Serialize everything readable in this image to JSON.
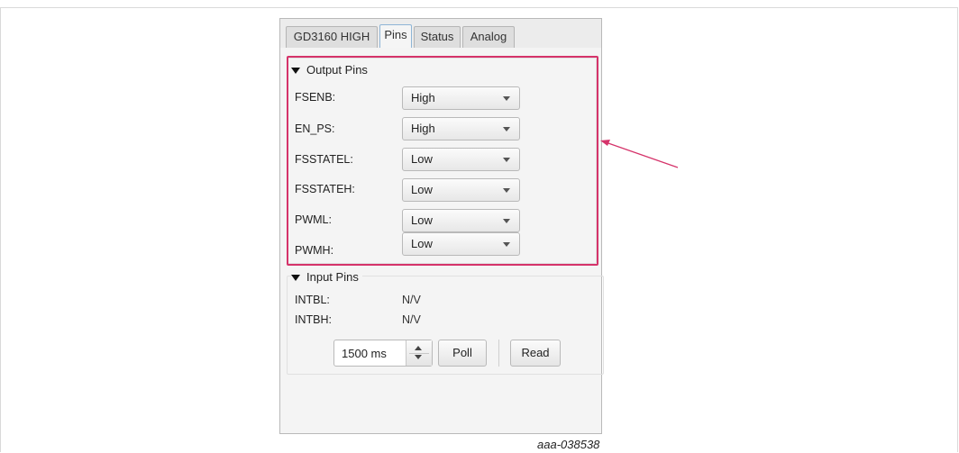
{
  "tabs": [
    {
      "label": "GD3160 HIGH"
    },
    {
      "label": "Pins"
    },
    {
      "label": "Status"
    },
    {
      "label": "Analog"
    }
  ],
  "active_tab": "Pins",
  "output_pins": {
    "title": "Output Pins",
    "rows": [
      {
        "label": "FSENB:",
        "value": "High"
      },
      {
        "label": "EN_PS:",
        "value": "High"
      },
      {
        "label": "FSSTATEL:",
        "value": "Low"
      },
      {
        "label": "FSSTATEH:",
        "value": "Low"
      },
      {
        "label": "PWML:",
        "value": "Low"
      },
      {
        "label": "PWMH:",
        "value": "Low"
      }
    ]
  },
  "input_pins": {
    "title": "Input Pins",
    "rows": [
      {
        "label": "INTBL:",
        "value": "N/V"
      },
      {
        "label": "INTBH:",
        "value": "N/V"
      }
    ]
  },
  "poll_interval": {
    "value": "1500 ms"
  },
  "buttons": {
    "poll": "Poll",
    "read": "Read"
  },
  "caption": "aaa-038538",
  "colors": {
    "highlight": "#d5336a",
    "annotation_arrow": "#d5336a"
  }
}
